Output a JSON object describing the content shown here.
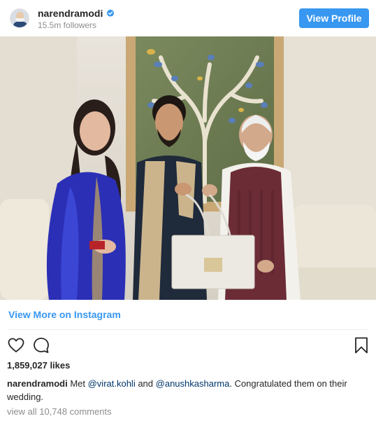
{
  "header": {
    "username": "narendramodi",
    "followers": "15.5m followers",
    "view_profile_label": "View Profile",
    "verified_color": "#3897f0"
  },
  "post": {
    "view_more_label": "View More on Instagram",
    "likes": "1,859,027 likes",
    "caption": {
      "username": "narendramodi",
      "text_1": "Met ",
      "mention_1": "@virat.kohli",
      "text_2": " and ",
      "mention_2": "@anushkasharma",
      "text_3": ". Congratulated them on their wedding."
    },
    "comments_label": "view all 10,748 comments"
  },
  "icons": [
    "heart-icon",
    "comment-icon",
    "bookmark-icon",
    "verified-badge-icon"
  ],
  "colors": {
    "accent": "#3897f0",
    "muted": "#8e8e8e",
    "mention": "#003569"
  }
}
